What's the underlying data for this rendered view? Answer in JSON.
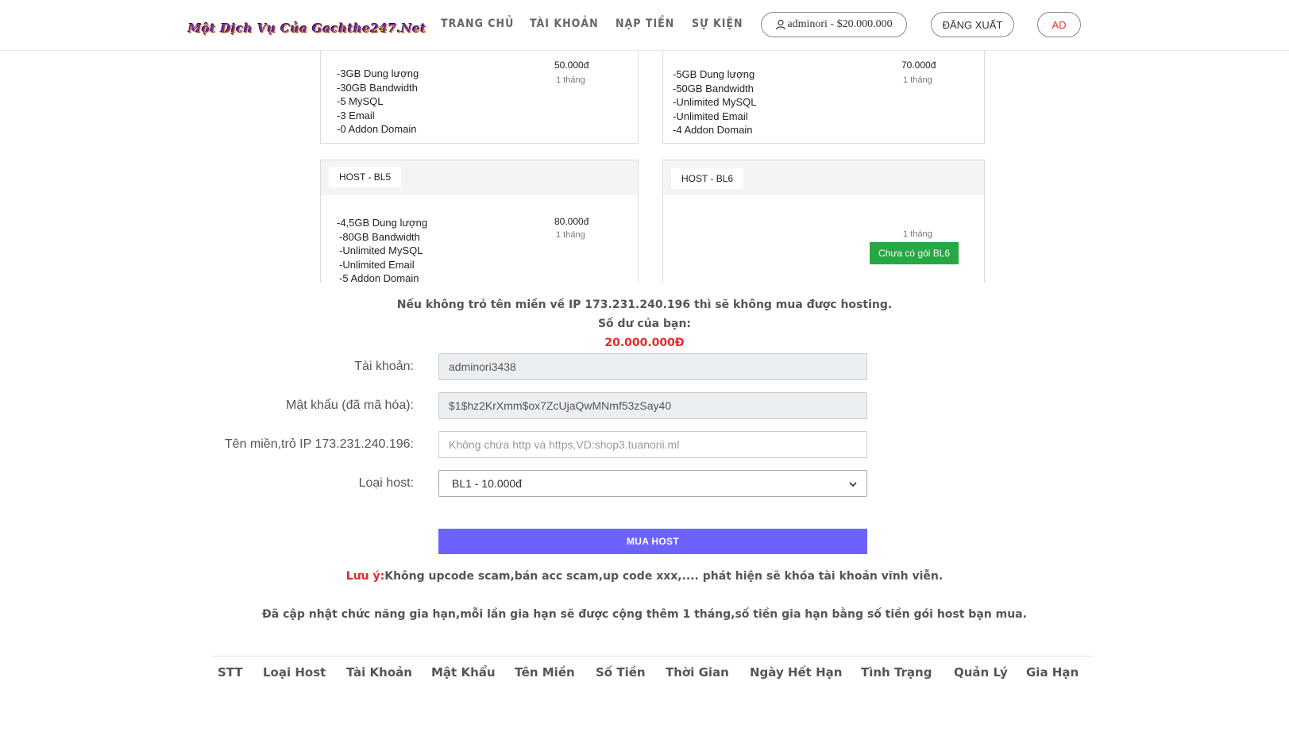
{
  "header": {
    "logo_text": "Một Dịch Vụ Của Gachthe247.Net",
    "nav": [
      "TRANG CHỦ",
      "TÀI KHOẢN",
      "NẠP TIỀN",
      "SỰ KIỆN"
    ],
    "user_label": "adminori - $20.000.000",
    "logout_label": "ĐĂNG XUẤT",
    "ad_label": "AD"
  },
  "cards": [
    {
      "features": [
        "-3GB Dung lượng",
        "-30GB Bandwidth",
        "-5 MySQL",
        "-3 Email",
        "-0 Addon Domain"
      ],
      "price": "50.000đ",
      "period": "1 tháng"
    },
    {
      "features": [
        "-5GB Dung lượng",
        "-50GB Bandwidth",
        "-Unlimited MySQL",
        "-Unlimited Email",
        "-4 Addon Domain"
      ],
      "price": "70.000đ",
      "period": "1 tháng"
    },
    {
      "title": "HOST - BL5",
      "features": [
        "-4,5GB Dung lượng",
        "-80GB Bandwidth",
        "-Unlimited MySQL",
        "-Unlimited Email",
        "-5 Addon Domain"
      ],
      "price": "80.000đ",
      "period": "1 tháng"
    },
    {
      "title": "HOST - BL6",
      "period": "1 tháng",
      "button": "Chưa có gói BL6"
    }
  ],
  "info": {
    "warning": "Nếu không trỏ tên miền về IP 173.231.240.196 thì sẽ không mua được hosting.",
    "balance_label": "Số dư của bạn:",
    "balance_value": "20.000.000Đ"
  },
  "form": {
    "account_label": "Tài khoản:",
    "account_value": "adminori3438",
    "password_label": "Mật khẩu (đã mã hóa):",
    "password_value": "$1$hz2KrXmm$ox7ZcUjaQwMNmf53zSay40",
    "domain_label": "Tên miền,trỏ IP 173.231.240.196:",
    "domain_placeholder": "Không chứa http và https,VD:shop3.tuanorii.ml",
    "type_label": "Loại host:",
    "type_value": "BL1 - 10.000đ",
    "submit_label": "MUA HOST"
  },
  "notes": {
    "note_prefix": "Lưu ý:",
    "note_text": "Không upcode scam,bán acc scam,up code xxx,.... phát hiện sẽ khóa tài khoản vĩnh viễn.",
    "update_text": "Đã cập nhật chức năng gia hạn,mỗi lần gia hạn sẽ được cộng thêm 1 tháng,số tiền gia hạn bằng số tiền gói host bạn mua."
  },
  "table": {
    "headers": [
      "STT",
      "Loại Host",
      "Tài Khoản",
      "Mật Khẩu",
      "Tên Miền",
      "Số Tiền",
      "Thời Gian",
      "Ngày Hết Hạn",
      "Tình Trạng",
      "Quản Lý",
      "Gia Hạn"
    ]
  },
  "colors": {
    "accent_button": "#6c63ff",
    "green_button": "#28a745",
    "red_text": "#e32b2b"
  }
}
